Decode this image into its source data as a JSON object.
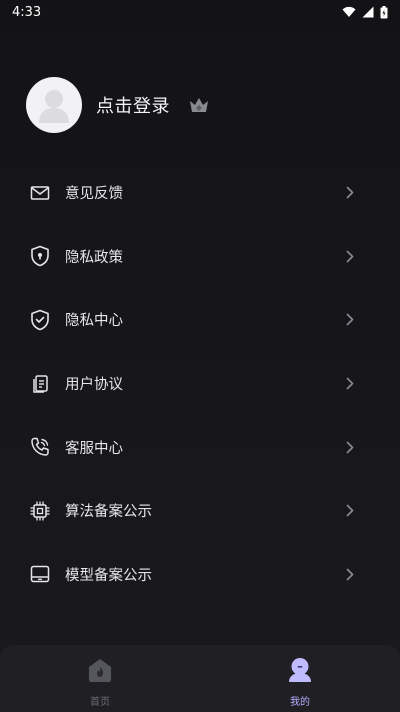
{
  "status_bar": {
    "time": "4:33"
  },
  "profile": {
    "login_label": "点击登录"
  },
  "menu": {
    "items": [
      {
        "label": "意见反馈",
        "icon": "mail-icon"
      },
      {
        "label": "隐私政策",
        "icon": "shield-lock-icon"
      },
      {
        "label": "隐私中心",
        "icon": "shield-check-icon"
      },
      {
        "label": "用户协议",
        "icon": "document-icon"
      },
      {
        "label": "客服中心",
        "icon": "phone-icon"
      },
      {
        "label": "算法备案公示",
        "icon": "chip-icon"
      },
      {
        "label": "模型备案公示",
        "icon": "tablet-icon"
      }
    ]
  },
  "tabbar": {
    "tabs": [
      {
        "label": "首页",
        "icon": "home-flame-icon",
        "active": false
      },
      {
        "label": "我的",
        "icon": "user-icon",
        "active": true
      }
    ]
  },
  "colors": {
    "background": "#131316",
    "tabbar": "#1f1f24",
    "accent": "#b5b0ff",
    "text": "#e6e6ea",
    "muted": "#6d6d74"
  }
}
